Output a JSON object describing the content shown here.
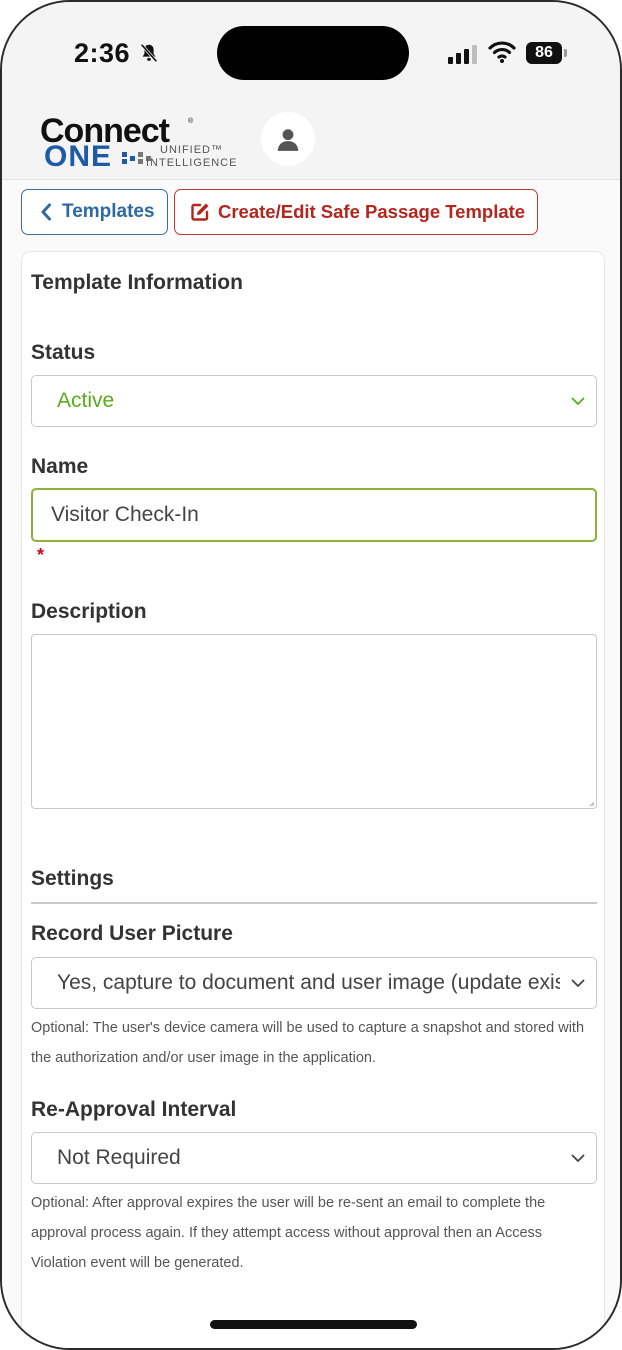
{
  "status_bar": {
    "time": "2:36",
    "battery": "86",
    "icons": [
      "bell-slash-icon",
      "signal-icon",
      "wifi-icon",
      "battery-icon"
    ]
  },
  "header": {
    "logo_connect": "Connect",
    "logo_reg": "®",
    "logo_one": "ONE",
    "logo_sub1": "UNIFIED™",
    "logo_sub2": "INTELLIGENCE",
    "avatar_icon": "user-icon"
  },
  "toolbar": {
    "back_label": "Templates",
    "edit_label": "Create/Edit Safe Passage Template"
  },
  "form": {
    "section_info": "Template Information",
    "status_label": "Status",
    "status_value": "Active",
    "name_label": "Name",
    "name_value": "Visitor Check-In",
    "required_mark": "*",
    "description_label": "Description",
    "description_value": "",
    "section_settings": "Settings",
    "record_picture_label": "Record User Picture",
    "record_picture_value": "Yes, capture to document and user image (update existing)",
    "record_picture_help": "Optional: The user's device camera will be used to capture a snapshot and stored with the authorization and/or user image in the application.",
    "reapproval_label": "Re-Approval Interval",
    "reapproval_value": "Not Required",
    "reapproval_help": "Optional: After approval expires the user will be re-sent an email to complete the approval process again. If they attempt access without approval then an Access Violation event will be generated."
  },
  "colors": {
    "primary_blue": "#2d6aa3",
    "danger_red": "#b3261e",
    "active_green": "#5aab1e",
    "focus_green": "#8db33a"
  }
}
